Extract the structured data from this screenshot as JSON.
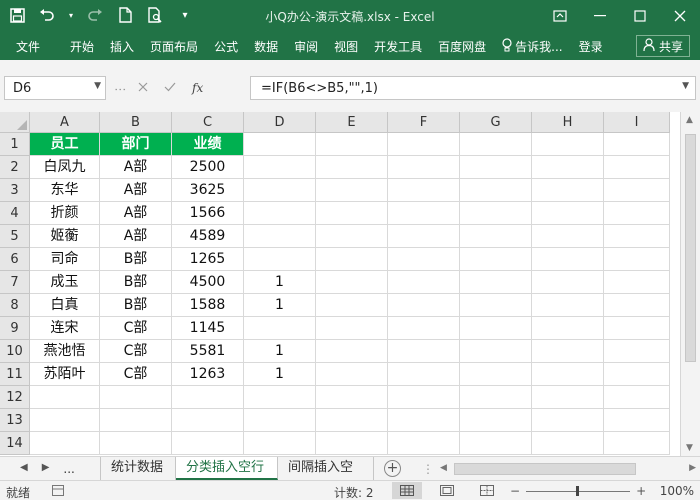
{
  "window": {
    "title": "小Q办公-演示文稿.xlsx - Excel"
  },
  "quick_access": [
    "save-icon",
    "undo-icon",
    "redo-icon",
    "new-file-icon",
    "print-preview-icon",
    "customize-icon"
  ],
  "menu": {
    "items": [
      "文件",
      "开始",
      "插入",
      "页面布局",
      "公式",
      "数据",
      "审阅",
      "视图",
      "开发工具",
      "百度网盘",
      "告诉我...",
      "登录"
    ],
    "share_label": "共享"
  },
  "formula_bar": {
    "name_box": "D6",
    "formula": "=IF(B6<>B5,\"\",1)"
  },
  "sheet": {
    "columns": [
      "A",
      "B",
      "C",
      "D",
      "E",
      "F",
      "G",
      "H",
      "I"
    ],
    "rows": [
      "1",
      "2",
      "3",
      "4",
      "5",
      "6",
      "7",
      "8",
      "9",
      "10",
      "11",
      "12",
      "13",
      "14"
    ],
    "header_fill": "#00b050",
    "headers": [
      "员工",
      "部门",
      "业绩"
    ],
    "data": [
      [
        "白凤九",
        "A部",
        "2500",
        ""
      ],
      [
        "东华",
        "A部",
        "3625",
        ""
      ],
      [
        "折颜",
        "A部",
        "1566",
        ""
      ],
      [
        "姬蘅",
        "A部",
        "4589",
        ""
      ],
      [
        "司命",
        "B部",
        "1265",
        ""
      ],
      [
        "成玉",
        "B部",
        "4500",
        "1"
      ],
      [
        "白真",
        "B部",
        "1588",
        "1"
      ],
      [
        "连宋",
        "C部",
        "1145",
        ""
      ],
      [
        "燕池悟",
        "C部",
        "5581",
        "1"
      ],
      [
        "苏陌叶",
        "C部",
        "1263",
        "1"
      ]
    ]
  },
  "sheet_tabs": {
    "ellipsis": "...",
    "tabs": [
      "统计数据",
      "分类插入空行",
      "间隔插入空"
    ],
    "active_index": 1
  },
  "status": {
    "ready": "就绪",
    "count": "计数: 2",
    "zoom": "100%"
  },
  "colors": {
    "excel_green": "#217346"
  }
}
